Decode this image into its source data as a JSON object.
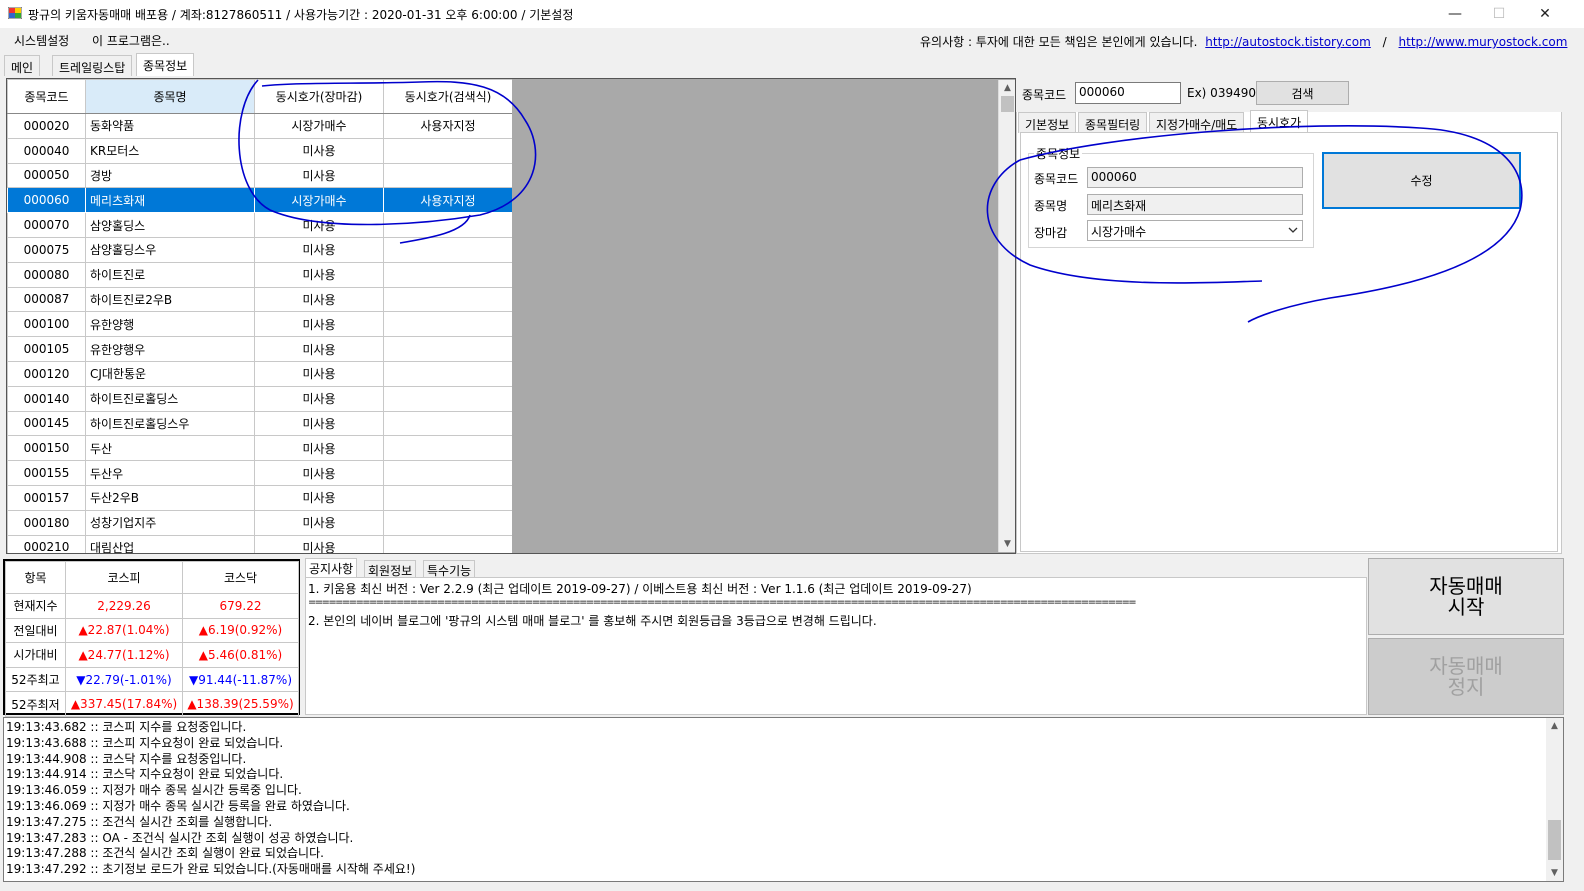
{
  "window": {
    "title": "팡규의 키움자동매매 배포용 / 계좌:8127860511 / 사용가능기간 : 2020-01-31 오후 6:00:00 / 기본설정",
    "minimize": "—",
    "maximize": "☐",
    "close": "✕"
  },
  "menu": {
    "items": [
      "시스템설정",
      "이 프로그램은.."
    ],
    "notice_prefix": "유의사항 : 투자에 대한 모든 책임은 본인에게 있습니다.",
    "link1": "http://autostock.tistory.com",
    "separator": "/",
    "link2": "http://www.muryostock.com"
  },
  "tabs": [
    "메인",
    "트레일링스탑",
    "종목정보"
  ],
  "grid": {
    "columns": [
      "종목코드",
      "종목명",
      "동시호가(장마감)",
      "동시호가(검색식)"
    ],
    "rows": [
      {
        "code": "000020",
        "name": "동화약품",
        "close": "시장가매수",
        "search": "사용자지정"
      },
      {
        "code": "000040",
        "name": "KR모터스",
        "close": "미사용",
        "search": ""
      },
      {
        "code": "000050",
        "name": "경방",
        "close": "미사용",
        "search": ""
      },
      {
        "code": "000060",
        "name": "메리츠화재",
        "close": "시장가매수",
        "search": "사용자지정"
      },
      {
        "code": "000070",
        "name": "삼양홀딩스",
        "close": "미사용",
        "search": ""
      },
      {
        "code": "000075",
        "name": "삼양홀딩스우",
        "close": "미사용",
        "search": ""
      },
      {
        "code": "000080",
        "name": "하이트진로",
        "close": "미사용",
        "search": ""
      },
      {
        "code": "000087",
        "name": "하이트진로2우B",
        "close": "미사용",
        "search": ""
      },
      {
        "code": "000100",
        "name": "유한양행",
        "close": "미사용",
        "search": ""
      },
      {
        "code": "000105",
        "name": "유한양행우",
        "close": "미사용",
        "search": ""
      },
      {
        "code": "000120",
        "name": "CJ대한통운",
        "close": "미사용",
        "search": ""
      },
      {
        "code": "000140",
        "name": "하이트진로홀딩스",
        "close": "미사용",
        "search": ""
      },
      {
        "code": "000145",
        "name": "하이트진로홀딩스우",
        "close": "미사용",
        "search": ""
      },
      {
        "code": "000150",
        "name": "두산",
        "close": "미사용",
        "search": ""
      },
      {
        "code": "000155",
        "name": "두산우",
        "close": "미사용",
        "search": ""
      },
      {
        "code": "000157",
        "name": "두산2우B",
        "close": "미사용",
        "search": ""
      },
      {
        "code": "000180",
        "name": "성창기업지주",
        "close": "미사용",
        "search": ""
      },
      {
        "code": "000210",
        "name": "대림산업",
        "close": "미사용",
        "search": ""
      }
    ],
    "selected_row": 3
  },
  "right": {
    "code_label": "종목코드",
    "code_value": "000060",
    "example": "Ex) 039490",
    "search_button": "검색",
    "tabs": [
      "기본정보",
      "종목필터링",
      "지정가매수/매도",
      "동시호가"
    ],
    "group_title": "종목정보",
    "field_code_label": "종목코드",
    "field_code_value": "000060",
    "field_name_label": "종목명",
    "field_name_value": "메리츠화재",
    "field_close_label": "장마감",
    "field_close_value": "시장가매수",
    "edit_button": "수정"
  },
  "index": {
    "headers": [
      "항목",
      "코스피",
      "코스닥"
    ],
    "rows": [
      {
        "label": "현재지수",
        "kospi": "2,229.26",
        "kosdaq": "679.22",
        "kospi_dir": "up",
        "kosdaq_dir": "up"
      },
      {
        "label": "전일대비",
        "kospi": "▲22.87(1.04%)",
        "kosdaq": "▲6.19(0.92%)",
        "kospi_dir": "up",
        "kosdaq_dir": "up"
      },
      {
        "label": "시가대비",
        "kospi": "▲24.77(1.12%)",
        "kosdaq": "▲5.46(0.81%)",
        "kospi_dir": "up",
        "kosdaq_dir": "up"
      },
      {
        "label": "52주최고",
        "kospi": "▼22.79(-1.01%)",
        "kosdaq": "▼91.44(-11.87%)",
        "kospi_dir": "down",
        "kosdaq_dir": "down"
      },
      {
        "label": "52주최저",
        "kospi": "▲337.45(17.84%)",
        "kosdaq": "▲138.39(25.59%)",
        "kospi_dir": "up",
        "kosdaq_dir": "up"
      }
    ]
  },
  "notice": {
    "tabs": [
      "공지사항",
      "회원정보",
      "특수기능"
    ],
    "lines": [
      "1. 키움용 최신 버전 : Ver 2.2.9 (최근 업데이트 2019-09-27) / 이베스트용 최신 버전 : Ver 1.1.6 (최근 업데이트 2019-09-27)",
      "==========================================================================================================================",
      "2. 본인의 네이버 블로그에 '팡규의 시스템 매매 블로그' 를 홍보해 주시면 회원등급을 3등급으로 변경해 드립니다."
    ]
  },
  "buttons": {
    "start_line1": "자동매매",
    "start_line2": "시작",
    "stop_line1": "자동매매",
    "stop_line2": "정지"
  },
  "log": [
    "19:13:43.682 :: 코스피 지수를 요청중입니다.",
    "19:13:43.688 :: 코스피 지수요청이 완료 되었습니다.",
    "19:13:44.908 :: 코스닥 지수를 요청중입니다.",
    "19:13:44.914 :: 코스닥 지수요청이 완료 되었습니다.",
    "19:13:46.059 :: 지정가 매수 종목 실시간 등록중 입니다.",
    "19:13:46.069 :: 지정가 매수 종목 실시간 등록을 완료 하였습니다.",
    "19:13:47.275 :: 조건식 실시간 조회를 실행합니다.",
    "19:13:47.283 :: OA - 조건식 실시간 조회 실행이 성공 하였습니다.",
    "19:13:47.288 :: 조건식 실시간 조회 실행이 완료 되었습니다.",
    "19:13:47.292 :: 초기정보 로드가 완료 되었습니다.(자동매매를 시작해 주세요!)"
  ],
  "colors": {
    "selection": "#0078d7",
    "up": "#ff0000",
    "down": "#0000ff",
    "annotation": "#0000cc",
    "link": "#0000cc"
  },
  "icons": [
    "app-icon",
    "minimize-icon",
    "maximize-icon",
    "close-icon",
    "scroll-up-icon",
    "scroll-down-icon",
    "dropdown-chevron-icon"
  ]
}
